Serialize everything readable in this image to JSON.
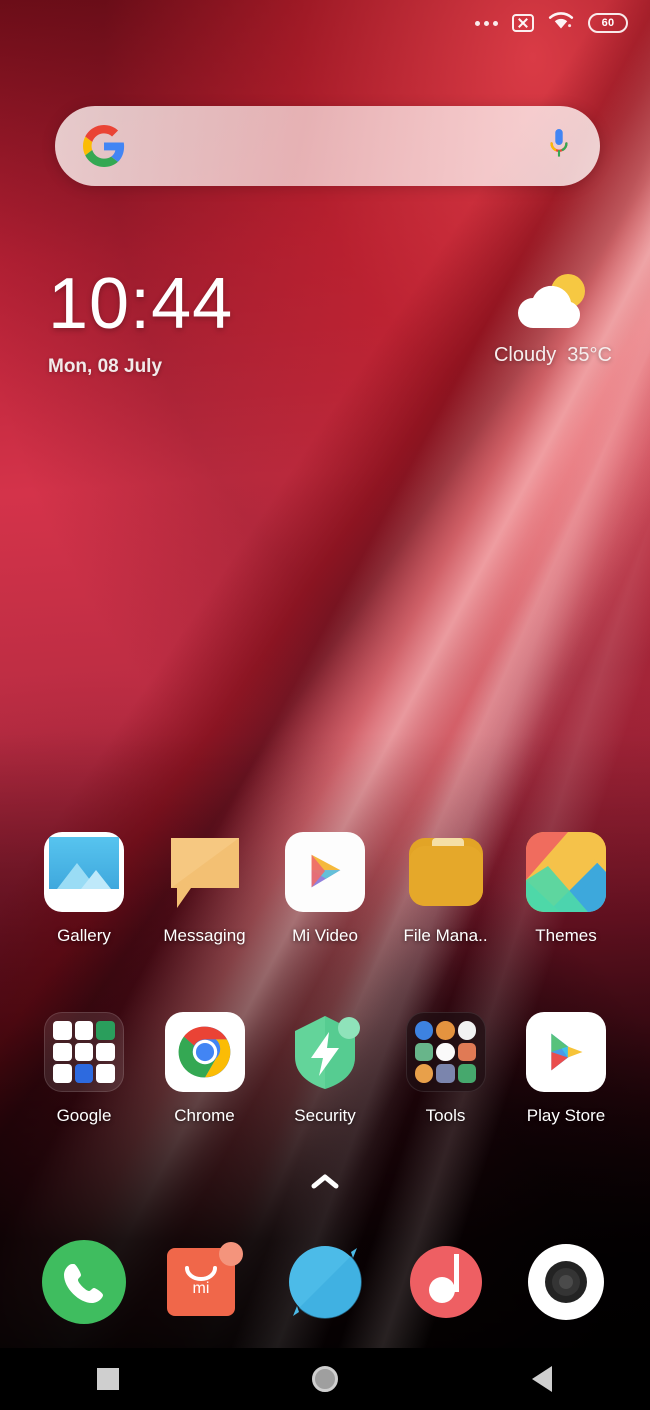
{
  "status_bar": {
    "more_icon": "more-dots-icon",
    "sim_icon": "no-sim-icon",
    "wifi_icon": "wifi-icon",
    "battery_icon": "battery-icon",
    "battery_level": "60"
  },
  "search": {
    "placeholder": "",
    "value": "",
    "google_icon": "google-g-icon",
    "mic_icon": "microphone-icon"
  },
  "clock_widget": {
    "time": "10:44",
    "date": "Mon, 08 July"
  },
  "weather_widget": {
    "icon": "cloudy-sun-icon",
    "condition": "Cloudy",
    "temperature": "35°C",
    "text": "Cloudy  35°C"
  },
  "home_screen": {
    "row1": [
      {
        "label": "Gallery",
        "icon": "gallery-icon"
      },
      {
        "label": "Messaging",
        "icon": "messaging-icon"
      },
      {
        "label": "Mi Video",
        "icon": "mi-video-icon"
      },
      {
        "label": "File Mana..",
        "icon": "file-manager-icon"
      },
      {
        "label": "Themes",
        "icon": "themes-icon"
      }
    ],
    "row2": [
      {
        "label": "Google",
        "icon": "google-folder-icon"
      },
      {
        "label": "Chrome",
        "icon": "chrome-icon"
      },
      {
        "label": "Security",
        "icon": "security-shield-icon"
      },
      {
        "label": "Tools",
        "icon": "tools-folder-icon"
      },
      {
        "label": "Play Store",
        "icon": "play-store-icon"
      }
    ]
  },
  "app_drawer_arrow": {
    "icon": "chevron-up-icon"
  },
  "dock": [
    {
      "name": "Phone",
      "icon": "phone-icon"
    },
    {
      "name": "Mi Store",
      "icon": "mi-store-icon"
    },
    {
      "name": "Browser",
      "icon": "browser-icon"
    },
    {
      "name": "Music",
      "icon": "music-icon"
    },
    {
      "name": "Camera",
      "icon": "camera-icon"
    }
  ],
  "nav_bar": [
    {
      "name": "Recents",
      "icon": "square-icon"
    },
    {
      "name": "Home",
      "icon": "circle-icon"
    },
    {
      "name": "Back",
      "icon": "triangle-back-icon"
    }
  ],
  "colors": {
    "wallpaper_red": "#c92b41",
    "wallpaper_dark": "#120308",
    "gallery_blue": "#4db8e8",
    "messaging_orange": "#f0b860",
    "folder_orange": "#e8a626",
    "security_green": "#5ed398",
    "phone_green": "#3fbd5f",
    "mi_orange": "#f0674a",
    "browser_blue": "#4cbbe8",
    "music_red": "#ee5f63",
    "nav_grey": "#cfcfcf"
  }
}
